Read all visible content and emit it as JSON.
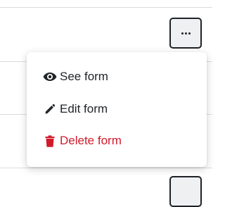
{
  "row_actions": {
    "more_button_icon": "ellipsis-icon"
  },
  "dropdown_menu": {
    "items": [
      {
        "label": "See form",
        "icon": "eye-icon",
        "color": "#212529"
      },
      {
        "label": "Edit form",
        "icon": "pencil-icon",
        "color": "#212529"
      },
      {
        "label": "Delete form",
        "icon": "trash-icon",
        "color": "#d11a2a"
      }
    ]
  }
}
